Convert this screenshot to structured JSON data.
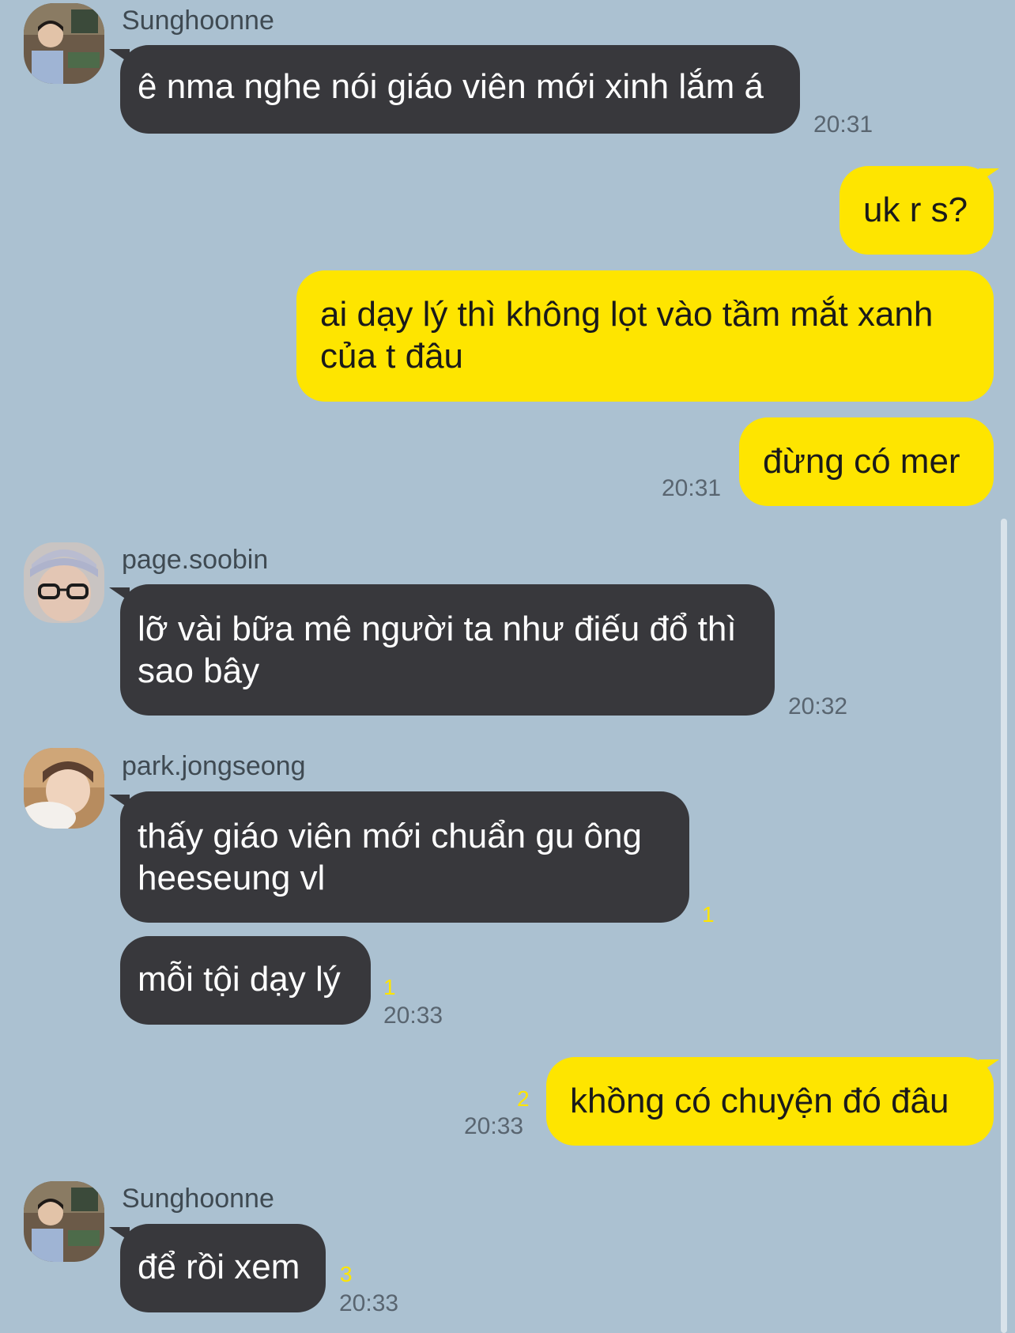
{
  "colors": {
    "background": "#abc1d1",
    "incoming_bubble": "#38383c",
    "outgoing_bubble": "#fee500",
    "unread_count": "#fee500"
  },
  "messages": [
    {
      "sender": "Sunghoonne",
      "avatar": "sunghoonne-avatar",
      "lines": [
        "ê nma nghe nói giáo viên mới xinh lắm á"
      ],
      "time": "20:31"
    },
    {
      "lines": [
        "uk r s?"
      ]
    },
    {
      "lines": [
        "ai dạy lý thì không lọt vào tầm mắt xanh",
        "của t đâu"
      ]
    },
    {
      "lines": [
        "đừng có mer"
      ],
      "time": "20:31"
    },
    {
      "sender": "page.soobin",
      "avatar": "page-soobin-avatar",
      "lines": [
        "lỡ vài bữa mê người ta như điếu đổ thì",
        "sao bây"
      ],
      "time": "20:32"
    },
    {
      "sender": "park.jongseong",
      "avatar": "park-jongseong-avatar",
      "lines": [
        "thấy giáo viên mới chuẩn gu ông",
        "heeseung vl"
      ],
      "unread": "1"
    },
    {
      "lines": [
        "mỗi tội dạy lý"
      ],
      "unread": "1",
      "time": "20:33"
    },
    {
      "lines": [
        "khồng có chuyện đó đâu"
      ],
      "unread": "2",
      "time": "20:33"
    },
    {
      "sender": "Sunghoonne",
      "avatar": "sunghoonne-avatar",
      "lines": [
        "để rồi xem"
      ],
      "unread": "3",
      "time": "20:33"
    }
  ]
}
